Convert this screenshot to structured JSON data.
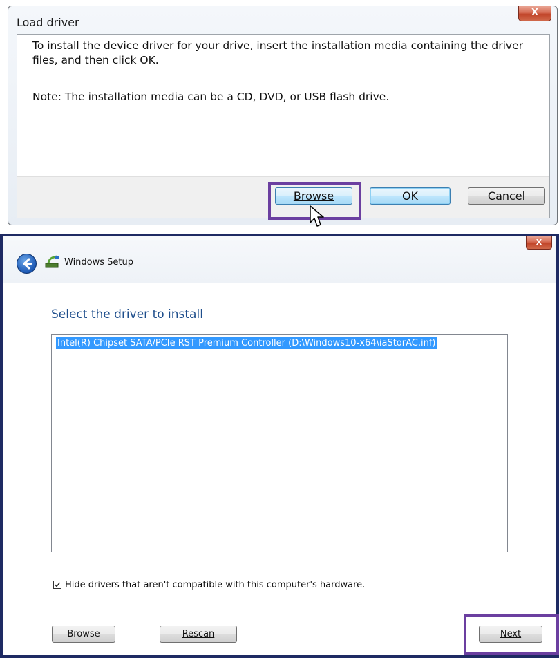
{
  "load_driver": {
    "title": "Load driver",
    "close_glyph": "X",
    "message": "To install the device driver for your drive, insert the installation media containing the driver files, and then click OK.",
    "note": "Note: The installation media can be a CD, DVD, or USB flash drive.",
    "browse_label": "Browse",
    "ok_label": "OK",
    "cancel_label": "Cancel"
  },
  "setup": {
    "window_title": "Windows Setup",
    "close_glyph": "X",
    "heading": "Select the driver to install",
    "drivers": [
      "Intel(R) Chipset SATA/PCIe RST Premium Controller (D:\\Windows10-x64\\iaStorAC.inf)"
    ],
    "hide_incompatible_label": "Hide drivers that aren't compatible with this computer's hardware.",
    "hide_incompatible_checked": true,
    "browse_label": "Browse",
    "rescan_label": "Rescan",
    "next_label": "Next"
  },
  "colors": {
    "highlight_box": "#6b3fa0",
    "selection": "#3399ff",
    "heading_blue": "#1e4e8c",
    "setup_frame": "#1e2a63"
  },
  "icons": [
    "close-icon",
    "back-arrow-icon",
    "windows-setup-icon",
    "mouse-cursor-icon",
    "checkmark-icon"
  ]
}
